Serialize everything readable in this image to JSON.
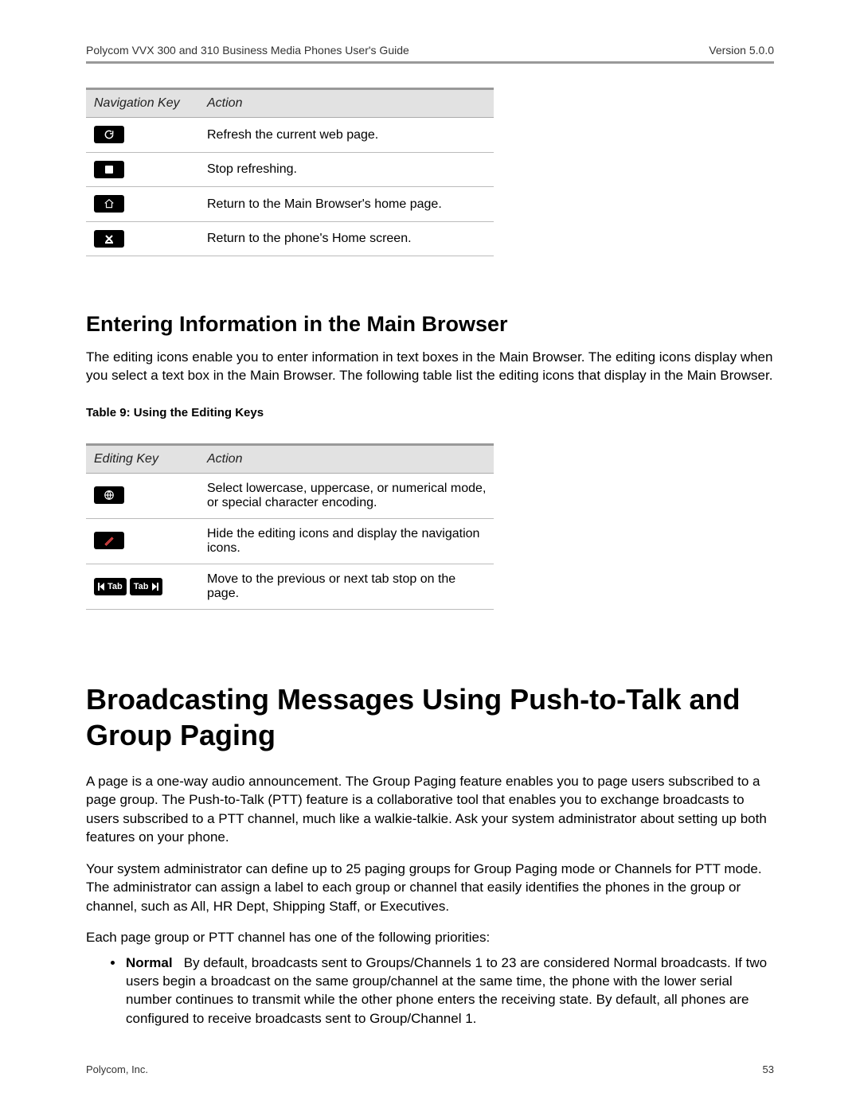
{
  "header": {
    "doc_title": "Polycom VVX 300 and 310 Business Media Phones User's Guide",
    "version": "Version 5.0.0"
  },
  "nav_table": {
    "headers": {
      "key": "Navigation Key",
      "action": "Action"
    },
    "rows": [
      {
        "icon": "refresh-icon",
        "action": "Refresh the current web page."
      },
      {
        "icon": "stop-icon",
        "action": "Stop refreshing."
      },
      {
        "icon": "home-icon",
        "action": "Return to the Main Browser's home page."
      },
      {
        "icon": "exit-icon",
        "action": "Return to the phone's Home screen."
      }
    ]
  },
  "section1": {
    "title": "Entering Information in the Main Browser",
    "para": "The editing icons enable you to enter information in text boxes in the Main Browser. The editing icons display when you select a text box in the Main Browser. The following table list the editing icons that display in the Main Browser.",
    "table_caption": "Table 9: Using the Editing Keys"
  },
  "edit_table": {
    "headers": {
      "key": "Editing Key",
      "action": "Action"
    },
    "rows": [
      {
        "icon": "abc-mode-icon",
        "action": "Select lowercase, uppercase, or numerical mode, or special character encoding."
      },
      {
        "icon": "edit-toggle-icon",
        "action": "Hide the editing icons and display the navigation icons."
      },
      {
        "icon": "tab-keys",
        "tab_label": "Tab",
        "action": "Move to the previous or next tab stop on the page."
      }
    ]
  },
  "chapter": {
    "title": "Broadcasting Messages Using Push-to-Talk and Group Paging",
    "para1": "A page is a one-way audio announcement. The Group Paging feature enables you to page users subscribed to a page group. The Push-to-Talk (PTT) feature is a collaborative tool that enables you to exchange broadcasts to users subscribed to a PTT channel, much like a walkie-talkie. Ask your system administrator about setting up both features on your phone.",
    "para2": "Your system administrator can define up to 25 paging groups for Group Paging mode or Channels for PTT mode. The administrator can assign a label to each group or channel that easily identifies the phones in the group or channel, such as All, HR Dept, Shipping Staff, or Executives.",
    "para3": "Each page group or PTT channel has one of the following priorities:",
    "priorities": [
      {
        "name": "Normal",
        "desc": "By default, broadcasts sent to Groups/Channels 1 to 23 are considered Normal broadcasts. If two users begin a broadcast on the same group/channel at the same time, the phone with the lower serial number continues to transmit while the other phone enters the receiving state. By default, all phones are configured to receive broadcasts sent to Group/Channel 1."
      }
    ]
  },
  "footer": {
    "company": "Polycom, Inc.",
    "page_number": "53"
  }
}
